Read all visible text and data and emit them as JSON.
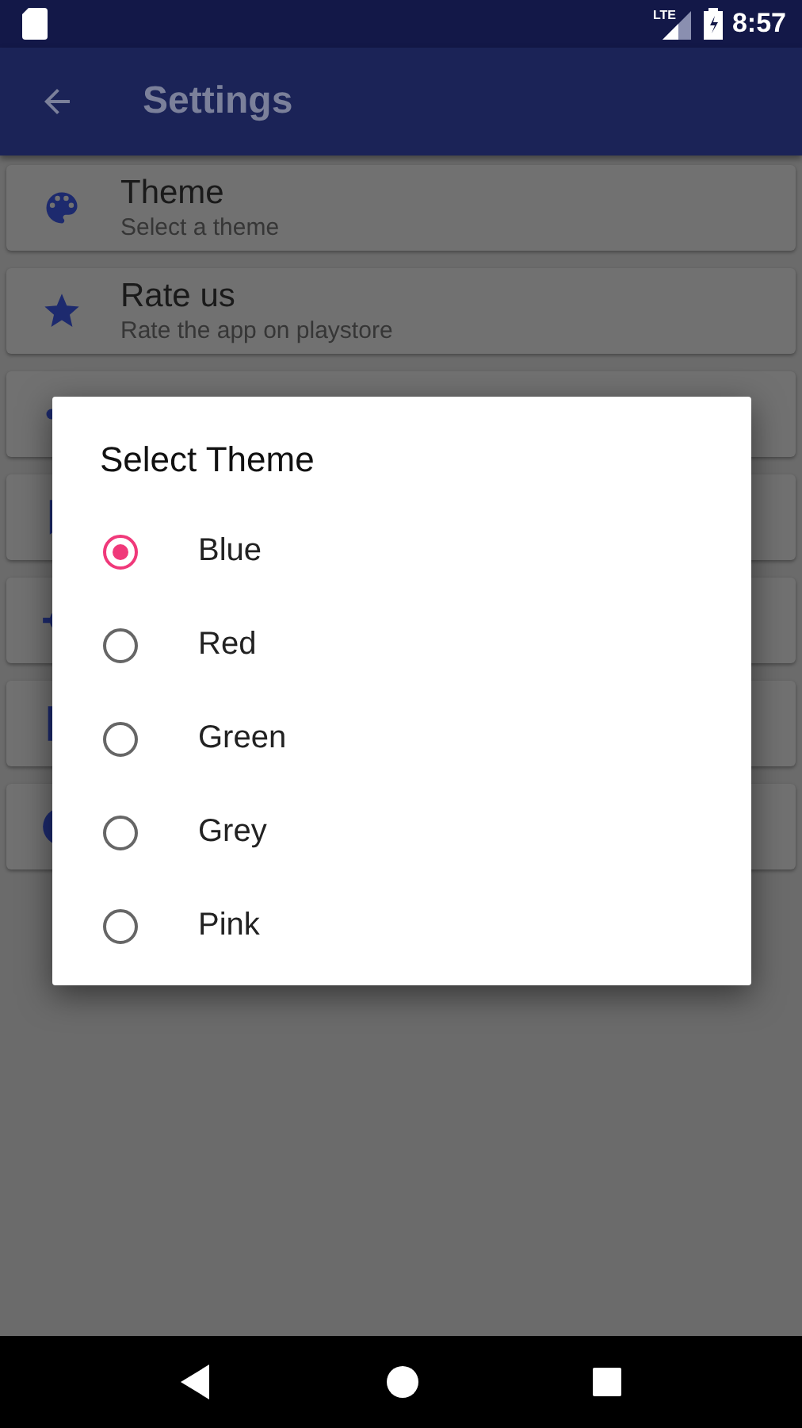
{
  "status_bar": {
    "time": "8:57",
    "network": "LTE"
  },
  "app_bar": {
    "title": "Settings"
  },
  "settings_items": [
    {
      "kind": "text",
      "title": "Theme",
      "subtitle": "Select a theme"
    },
    {
      "kind": "text",
      "title": "Rate us",
      "subtitle": "Rate the app on playstore"
    },
    {
      "kind": "covered"
    },
    {
      "kind": "covered"
    },
    {
      "kind": "covered"
    },
    {
      "kind": "covered"
    },
    {
      "kind": "covered"
    }
  ],
  "dialog": {
    "title": "Select Theme",
    "options": [
      {
        "label": "Blue",
        "selected": true
      },
      {
        "label": "Red",
        "selected": false
      },
      {
        "label": "Green",
        "selected": false
      },
      {
        "label": "Grey",
        "selected": false
      },
      {
        "label": "Pink",
        "selected": false
      }
    ]
  }
}
